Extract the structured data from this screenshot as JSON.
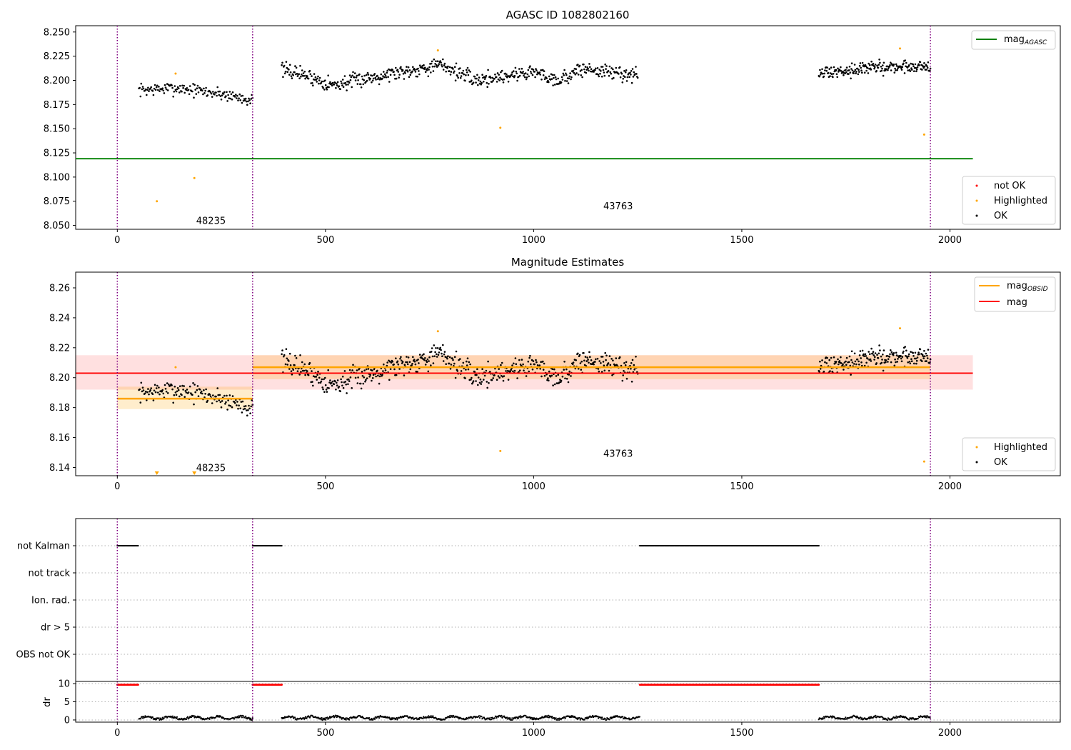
{
  "colors": {
    "ok": "#000000",
    "not_ok": "#ff0000",
    "highlighted": "#ffa500",
    "agasc": "#008000",
    "mag": "#ff0000",
    "mag_obsid": "#ffa500",
    "obs_boundary": "#800080"
  },
  "chart_data": [
    {
      "type": "scatter",
      "title": "AGASC ID 1082802160",
      "xlim": [
        -100,
        2265
      ],
      "ylim": [
        8.046,
        8.2565
      ],
      "xticks": [
        0,
        500,
        1000,
        1500,
        2000
      ],
      "yticks": [
        8.05,
        8.075,
        8.1,
        8.125,
        8.15,
        8.175,
        8.2,
        8.225,
        8.25
      ],
      "ytick_labels": [
        "8.050",
        "8.075",
        "8.100",
        "8.125",
        "8.150",
        "8.175",
        "8.200",
        "8.225",
        "8.250"
      ],
      "obs_boundaries": [
        0,
        325,
        1953
      ],
      "obs_labels": [
        {
          "text": "48235",
          "x": 162,
          "y": 8.0545
        },
        {
          "text": "43763",
          "x": 1140,
          "y": 8.0695
        }
      ],
      "agasc_line": {
        "value": 8.119,
        "x": [
          -100,
          2055
        ]
      },
      "highlighted_points": [
        [
          95,
          8.075
        ],
        [
          140,
          8.207
        ],
        [
          185,
          8.099
        ],
        [
          770,
          8.231
        ],
        [
          920,
          8.151
        ],
        [
          1880,
          8.233
        ],
        [
          1938,
          8.144
        ]
      ],
      "ok_segments": [
        {
          "x": [
            52,
            325
          ],
          "levels": [
            [
              52,
              8.19
            ],
            [
              150,
              8.192
            ],
            [
              250,
              8.186
            ],
            [
              325,
              8.18
            ]
          ],
          "spread": 0.012,
          "count": 150
        },
        {
          "x": [
            395,
            1250
          ],
          "levels": [
            [
              395,
              8.211
            ],
            [
              440,
              8.207
            ],
            [
              520,
              8.195
            ],
            [
              640,
              8.206
            ],
            [
              780,
              8.216
            ],
            [
              860,
              8.2
            ],
            [
              1000,
              8.209
            ],
            [
              1060,
              8.2
            ],
            [
              1120,
              8.212
            ],
            [
              1250,
              8.205
            ]
          ],
          "spread": 0.014,
          "count": 560
        },
        {
          "x": [
            1685,
            1953
          ],
          "levels": [
            [
              1685,
              8.207
            ],
            [
              1800,
              8.213
            ],
            [
              1953,
              8.215
            ]
          ],
          "spread": 0.012,
          "count": 200
        }
      ],
      "legend_lines": [
        {
          "label": "mag",
          "sub": "AGASC"
        }
      ],
      "legend_points": [
        {
          "label": "not OK"
        },
        {
          "label": "Highlighted"
        },
        {
          "label": "OK"
        }
      ]
    },
    {
      "type": "scatter",
      "title": "Magnitude Estimates",
      "xlim": [
        -100,
        2265
      ],
      "ylim": [
        8.1345,
        8.2705
      ],
      "xticks": [
        0,
        500,
        1000,
        1500,
        2000
      ],
      "yticks": [
        8.14,
        8.16,
        8.18,
        8.2,
        8.22,
        8.24,
        8.26
      ],
      "ytick_labels": [
        "8.14",
        "8.16",
        "8.18",
        "8.20",
        "8.22",
        "8.24",
        "8.26"
      ],
      "obs_boundaries": [
        0,
        325,
        1953
      ],
      "obs_labels": [
        {
          "text": "48235",
          "x": 162,
          "y": 8.1395
        },
        {
          "text": "43763",
          "x": 1140,
          "y": 8.149
        }
      ],
      "mag_line": {
        "value": 8.203,
        "band": [
          8.192,
          8.215
        ],
        "x": [
          -100,
          2055
        ]
      },
      "mag_obsid": [
        {
          "value": 8.186,
          "band": [
            8.179,
            8.194
          ],
          "x": [
            0,
            325
          ]
        },
        {
          "value": 8.207,
          "band": [
            8.199,
            8.215
          ],
          "x": [
            325,
            1953
          ]
        }
      ],
      "highlighted_points": [
        [
          140,
          8.207
        ],
        [
          770,
          8.231
        ],
        [
          920,
          8.151
        ],
        [
          1880,
          8.233
        ],
        [
          1938,
          8.144
        ]
      ],
      "highlighted_clipped": [
        95,
        185
      ],
      "legend_lines": [
        {
          "label": "mag",
          "sub": "OBSID"
        },
        {
          "label": "mag",
          "sub": ""
        }
      ],
      "legend_points": [
        {
          "label": "Highlighted"
        },
        {
          "label": "OK"
        }
      ]
    },
    {
      "type": "scatter",
      "xlim": [
        -100,
        2265
      ],
      "xticks": [
        0,
        500,
        1000,
        1500,
        2000
      ],
      "flag_rows": [
        "not Kalman",
        "not track",
        "Ion. rad.",
        "dr > 5",
        "OBS not OK"
      ],
      "not_kalman_ranges": [
        [
          0,
          50
        ],
        [
          325,
          395
        ],
        [
          1255,
          1685
        ]
      ],
      "dr_ylabel": "dr",
      "dr_ylim": [
        -0.6,
        10.6
      ],
      "dr_yticks": [
        0,
        5,
        10
      ],
      "dr_high_value": 9.7,
      "dr_ok_segments": [
        [
          52,
          325
        ],
        [
          395,
          1255
        ],
        [
          1685,
          1953
        ]
      ],
      "obs_boundaries": [
        0,
        325,
        1953
      ]
    }
  ]
}
